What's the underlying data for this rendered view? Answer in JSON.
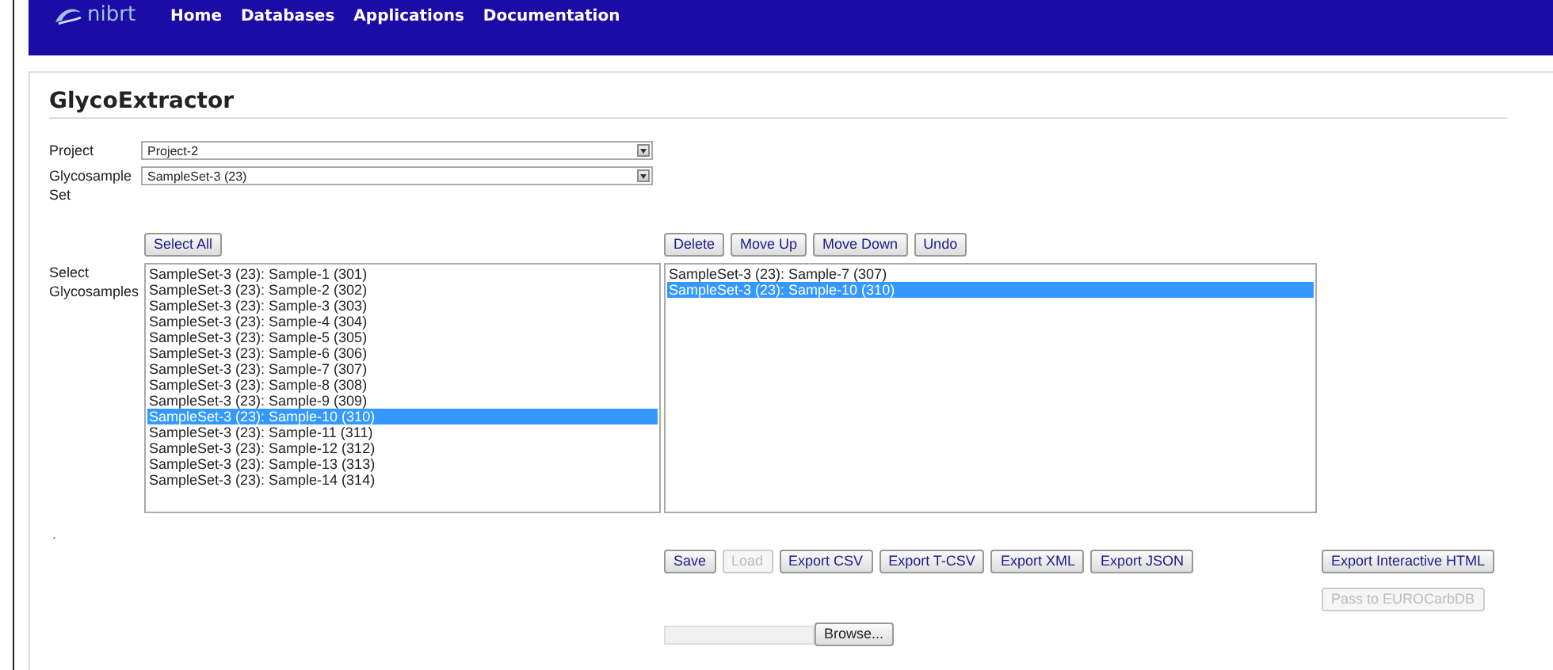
{
  "nav": {
    "logo": "nibrt",
    "links": [
      "Home",
      "Databases",
      "Applications",
      "Documentation"
    ]
  },
  "title": "GlycoExtractor",
  "fields": [
    {
      "label": "Project",
      "value": "Project-2"
    },
    {
      "label": "Glycosample Set",
      "value": "SampleSet-3 (23)"
    }
  ],
  "select_all": {
    "label": "Select All",
    "disabled": false
  },
  "list_buttons": [
    {
      "label": "Delete",
      "disabled": false
    },
    {
      "label": "Move Up",
      "disabled": false
    },
    {
      "label": "Move Down",
      "disabled": false
    },
    {
      "label": "Undo",
      "disabled": false
    }
  ],
  "samples_label": "Select Glycosamples",
  "available": [
    {
      "text": "SampleSet-3 (23): Sample-1 (301)",
      "selected": false
    },
    {
      "text": "SampleSet-3 (23): Sample-2 (302)",
      "selected": false
    },
    {
      "text": "SampleSet-3 (23): Sample-3 (303)",
      "selected": false
    },
    {
      "text": "SampleSet-3 (23): Sample-4 (304)",
      "selected": false
    },
    {
      "text": "SampleSet-3 (23): Sample-5 (305)",
      "selected": false
    },
    {
      "text": "SampleSet-3 (23): Sample-6 (306)",
      "selected": false
    },
    {
      "text": "SampleSet-3 (23): Sample-7 (307)",
      "selected": false
    },
    {
      "text": "SampleSet-3 (23): Sample-8 (308)",
      "selected": false
    },
    {
      "text": "SampleSet-3 (23): Sample-9 (309)",
      "selected": false
    },
    {
      "text": "SampleSet-3 (23): Sample-10 (310)",
      "selected": true
    },
    {
      "text": "SampleSet-3 (23): Sample-11 (311)",
      "selected": false
    },
    {
      "text": "SampleSet-3 (23): Sample-12 (312)",
      "selected": false
    },
    {
      "text": "SampleSet-3 (23): Sample-13 (313)",
      "selected": false
    },
    {
      "text": "SampleSet-3 (23): Sample-14 (314)",
      "selected": false
    }
  ],
  "chosen": [
    {
      "text": "SampleSet-3 (23): Sample-7 (307)",
      "selected": false
    },
    {
      "text": "SampleSet-3 (23): Sample-10 (310)",
      "selected": true
    }
  ],
  "note": ".",
  "actions": [
    {
      "label": "Save",
      "disabled": false
    },
    {
      "label": "Load",
      "disabled": true
    },
    {
      "label": "Export CSV",
      "disabled": false
    },
    {
      "label": "Export T-CSV",
      "disabled": false
    },
    {
      "label": "Export XML",
      "disabled": false
    },
    {
      "label": "Export JSON",
      "disabled": false
    }
  ],
  "side_actions": [
    {
      "label": "Export Interactive HTML",
      "disabled": false
    },
    {
      "label": "Pass to EUROCarbDB",
      "disabled": true
    }
  ],
  "browse": {
    "label": "Browse..."
  }
}
